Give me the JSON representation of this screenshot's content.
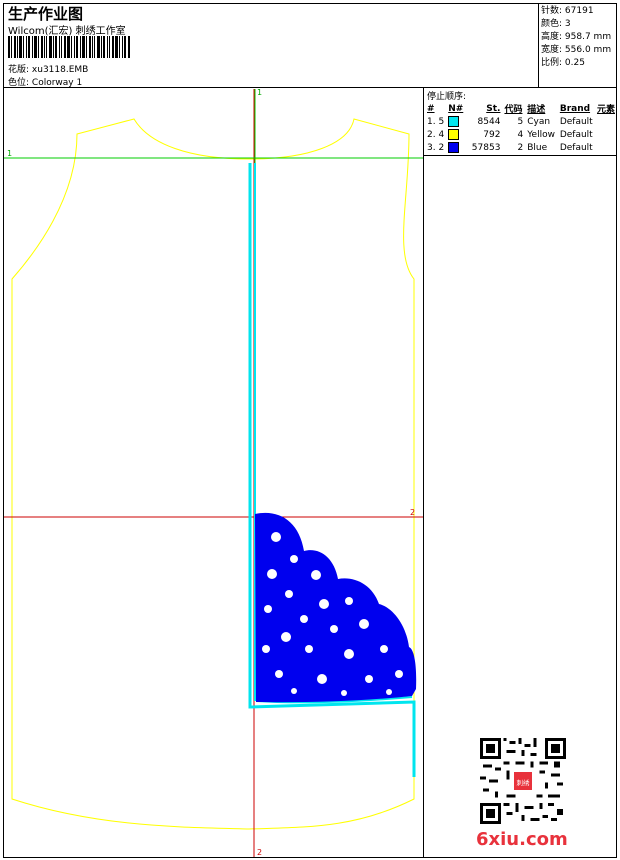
{
  "header": {
    "title": "生产作业图",
    "subtitle": "Wilcom(汇宏) 刺绣工作室",
    "design_label": "花版:",
    "design_value": "xu3118.EMB",
    "colorway_label": "色位:",
    "colorway_value": "Colorway 1"
  },
  "stats": {
    "stitches_label": "针数:",
    "stitches_value": "67191",
    "colors_label": "颜色:",
    "colors_value": "3",
    "height_label": "高度:",
    "height_value": "958.7 mm",
    "width_label": "宽度:",
    "width_value": "556.0 mm",
    "scale_label": "比例:",
    "scale_value": "0.25"
  },
  "legend": {
    "title": "停止顺序:",
    "columns": [
      "#",
      "N#",
      "St.",
      "代码",
      "描述",
      "Brand",
      "元素"
    ],
    "rows": [
      {
        "idx": "1. 5",
        "color": "#00e5ee",
        "st": "8544",
        "code": "5",
        "desc": "Cyan",
        "brand": "Default"
      },
      {
        "idx": "2. 4",
        "color": "#ffff00",
        "st": "792",
        "code": "4",
        "desc": "Yellow",
        "brand": "Default"
      },
      {
        "idx": "3. 2",
        "color": "#0000ee",
        "st": "57853",
        "code": "2",
        "desc": "Blue",
        "brand": "Default"
      }
    ]
  },
  "markers": {
    "m1_top": "1",
    "m1_left": "1",
    "m2_right": "2",
    "m2_bottom": "2"
  },
  "watermark": {
    "text": "6xiu.com",
    "stamp_text": "刺绣"
  },
  "colors": {
    "outline": "#ffff00",
    "cyan": "#00e5ee",
    "blue": "#0000ee",
    "red": "#cc0000",
    "green": "#00cc00",
    "watermark_red": "#e8323c"
  }
}
